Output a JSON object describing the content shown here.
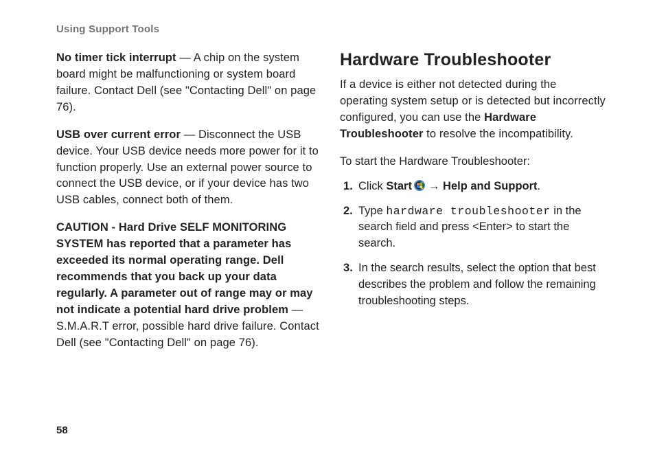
{
  "section_header": "Using Support Tools",
  "page_number": "58",
  "left": {
    "p1": {
      "label": "No timer tick interrupt",
      "text": " — A chip on the system board might be malfunctioning or system board failure. Contact Dell (see \"Contacting Dell\" on page 76)."
    },
    "p2": {
      "label": "USB over current error",
      "text": " — Disconnect the USB device. Your USB device needs more power for it to function properly. Use an external power source to connect the USB device, or if your device has two USB cables, connect both of them."
    },
    "p3": {
      "bold": "CAUTION - Hard Drive SELF MONITORING SYSTEM has reported that a parameter has exceeded its normal operating range. Dell recommends that you back up your data regularly. A parameter out of range may or may not indicate a potential hard drive problem",
      "text": " — S.M.A.R.T error, possible hard drive failure. Contact Dell (see \"Contacting Dell\" on page 76)."
    }
  },
  "right": {
    "title": "Hardware Troubleshooter",
    "intro_pre": "If a device is either not detected during the operating system setup or is detected but incorrectly configured, you can use the ",
    "intro_bold": "Hardware Troubleshooter",
    "intro_post": " to resolve the incompatibility.",
    "lead": "To start the Hardware Troubleshooter:",
    "steps": {
      "s1": {
        "pre": "Click ",
        "start": "Start",
        "arrow": "→",
        "help": "Help and Support",
        "post": "."
      },
      "s2": {
        "pre": "Type ",
        "cmd": "hardware troubleshooter",
        "post": " in the search field and press <Enter> to start the search."
      },
      "s3": "In the search results, select the option that best describes the problem and follow the remaining troubleshooting steps."
    }
  }
}
